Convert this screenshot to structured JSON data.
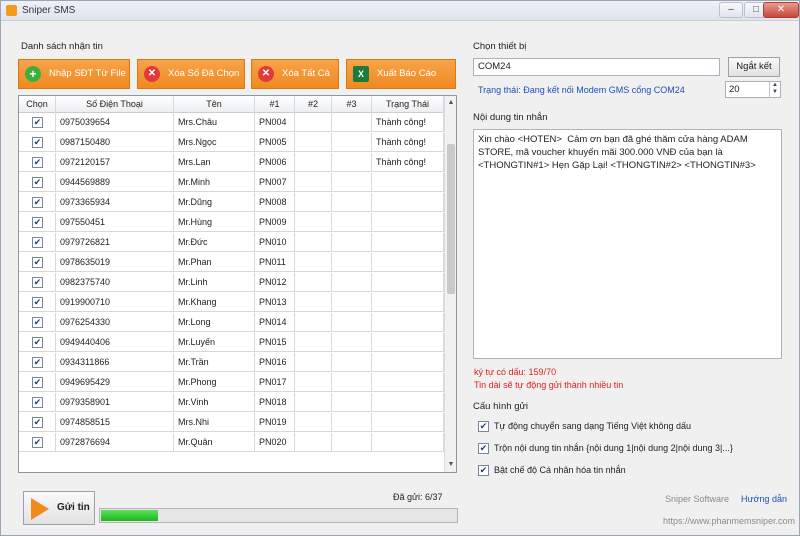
{
  "window": {
    "title": "Sniper SMS"
  },
  "left": {
    "section_title": "Danh sách nhận tin",
    "buttons": {
      "import": "Nhập SĐT Từ File",
      "delete_selected": "Xóa Số Đã Chọn",
      "delete_all": "Xóa Tất Cả",
      "export": "Xuất Báo Cáo"
    },
    "table": {
      "headers": [
        "Chọn",
        "Số Điện Thoại",
        "Tên",
        "#1",
        "#2",
        "#3",
        "Trạng Thái"
      ],
      "rows": [
        {
          "phone": "0975039654",
          "name": "Mrs.Châu",
          "p1": "PN004",
          "status": "Thành công!"
        },
        {
          "phone": "0987150480",
          "name": "Mrs.Ngọc",
          "p1": "PN005",
          "status": "Thành công!"
        },
        {
          "phone": "0972120157",
          "name": "Mrs.Lan",
          "p1": "PN006",
          "status": "Thành công!"
        },
        {
          "phone": "0944569889",
          "name": "Mr.Minh",
          "p1": "PN007",
          "status": ""
        },
        {
          "phone": "0973365934",
          "name": "Mr.Dũng",
          "p1": "PN008",
          "status": ""
        },
        {
          "phone": "097550451",
          "name": "Mr.Hùng",
          "p1": "PN009",
          "status": ""
        },
        {
          "phone": "0979726821",
          "name": "Mr.Đức",
          "p1": "PN010",
          "status": ""
        },
        {
          "phone": "0978635019",
          "name": "Mr.Phan",
          "p1": "PN011",
          "status": ""
        },
        {
          "phone": "0982375740",
          "name": "Mr.Linh",
          "p1": "PN012",
          "status": ""
        },
        {
          "phone": "0919900710",
          "name": "Mr.Khang",
          "p1": "PN013",
          "status": ""
        },
        {
          "phone": "0976254330",
          "name": "Mr.Long",
          "p1": "PN014",
          "status": ""
        },
        {
          "phone": "0949440406",
          "name": "Mr.Luyến",
          "p1": "PN015",
          "status": ""
        },
        {
          "phone": "0934311866",
          "name": "Mr.Trần",
          "p1": "PN016",
          "status": ""
        },
        {
          "phone": "0949695429",
          "name": "Mr.Phong",
          "p1": "PN017",
          "status": ""
        },
        {
          "phone": "0979358901",
          "name": "Mr.Vinh",
          "p1": "PN018",
          "status": ""
        },
        {
          "phone": "0974858515",
          "name": "Mrs.Nhi",
          "p1": "PN019",
          "status": ""
        },
        {
          "phone": "0972876694",
          "name": "Mr.Quân",
          "p1": "PN020",
          "status": ""
        }
      ]
    },
    "send_button": "Gửi tin",
    "sent_count": "Đã gửi: 6/37",
    "progress_fraction": 0.16
  },
  "right": {
    "device_label": "Chọn thiết bị",
    "port_value": "COM24",
    "disconnect_button": "Ngắt kết",
    "status": "Trạng thái: Đang kết nối Modem GMS cổng COM24",
    "spin_value": "20",
    "message_label": "Nội dung tin nhắn",
    "message": "Xin chào <HOTEN>  Cảm ơn bạn đã ghé thăm cửa hàng ADAM STORE, mã voucher khuyến mãi 300.000 VNĐ của bạn là <THONGTIN#1> Hẹn Gặp Lại! <THONGTIN#2> <THONGTIN#3>",
    "char_count": "ký tự có dấu: 159/70",
    "split_note": "Tin dài sẽ tự động gửi thành nhiều tin",
    "config_label": "Cấu hình gửi",
    "options": [
      "Tự động chuyển sang dạng Tiếng Việt không dấu",
      "Trộn nội dung tin nhắn {nội dung 1|nội dung 2|nội dung 3|...}",
      "Bật chế độ Cá nhân hóa tin nhắn"
    ],
    "brand": "Sniper Software",
    "help_link": "Hướng dẫn",
    "url": "https://www.phanmemsniper.com"
  }
}
